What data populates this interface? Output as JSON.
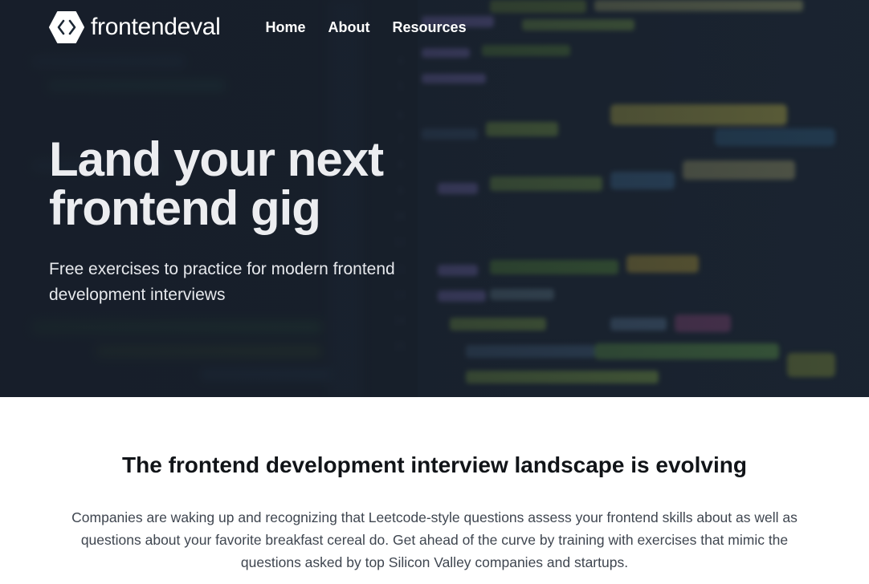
{
  "brand": {
    "name": "frontendeval",
    "logo_icon": "code-brackets-icon"
  },
  "nav": {
    "items": [
      {
        "label": "Home"
      },
      {
        "label": "About"
      },
      {
        "label": "Resources"
      }
    ]
  },
  "hero": {
    "title_line1": "Land your next",
    "title_line2": "frontend gig",
    "subtitle": "Free exercises to practice for modern frontend development interviews",
    "background": "blurred-code-editor-image"
  },
  "section": {
    "title": "The frontend development interview landscape is evolving",
    "body": "Companies are waking up and recognizing that Leetcode-style questions assess your frontend skills about as well as questions about your favorite breakfast cereal do. Get ahead of the curve by training with exercises that mimic the questions asked by top Silicon Valley companies and startups."
  },
  "colors": {
    "hero_bg": "#1b2634",
    "text_light": "#ffffff",
    "heading_dark": "#111418",
    "body_gray": "#3f4650"
  }
}
